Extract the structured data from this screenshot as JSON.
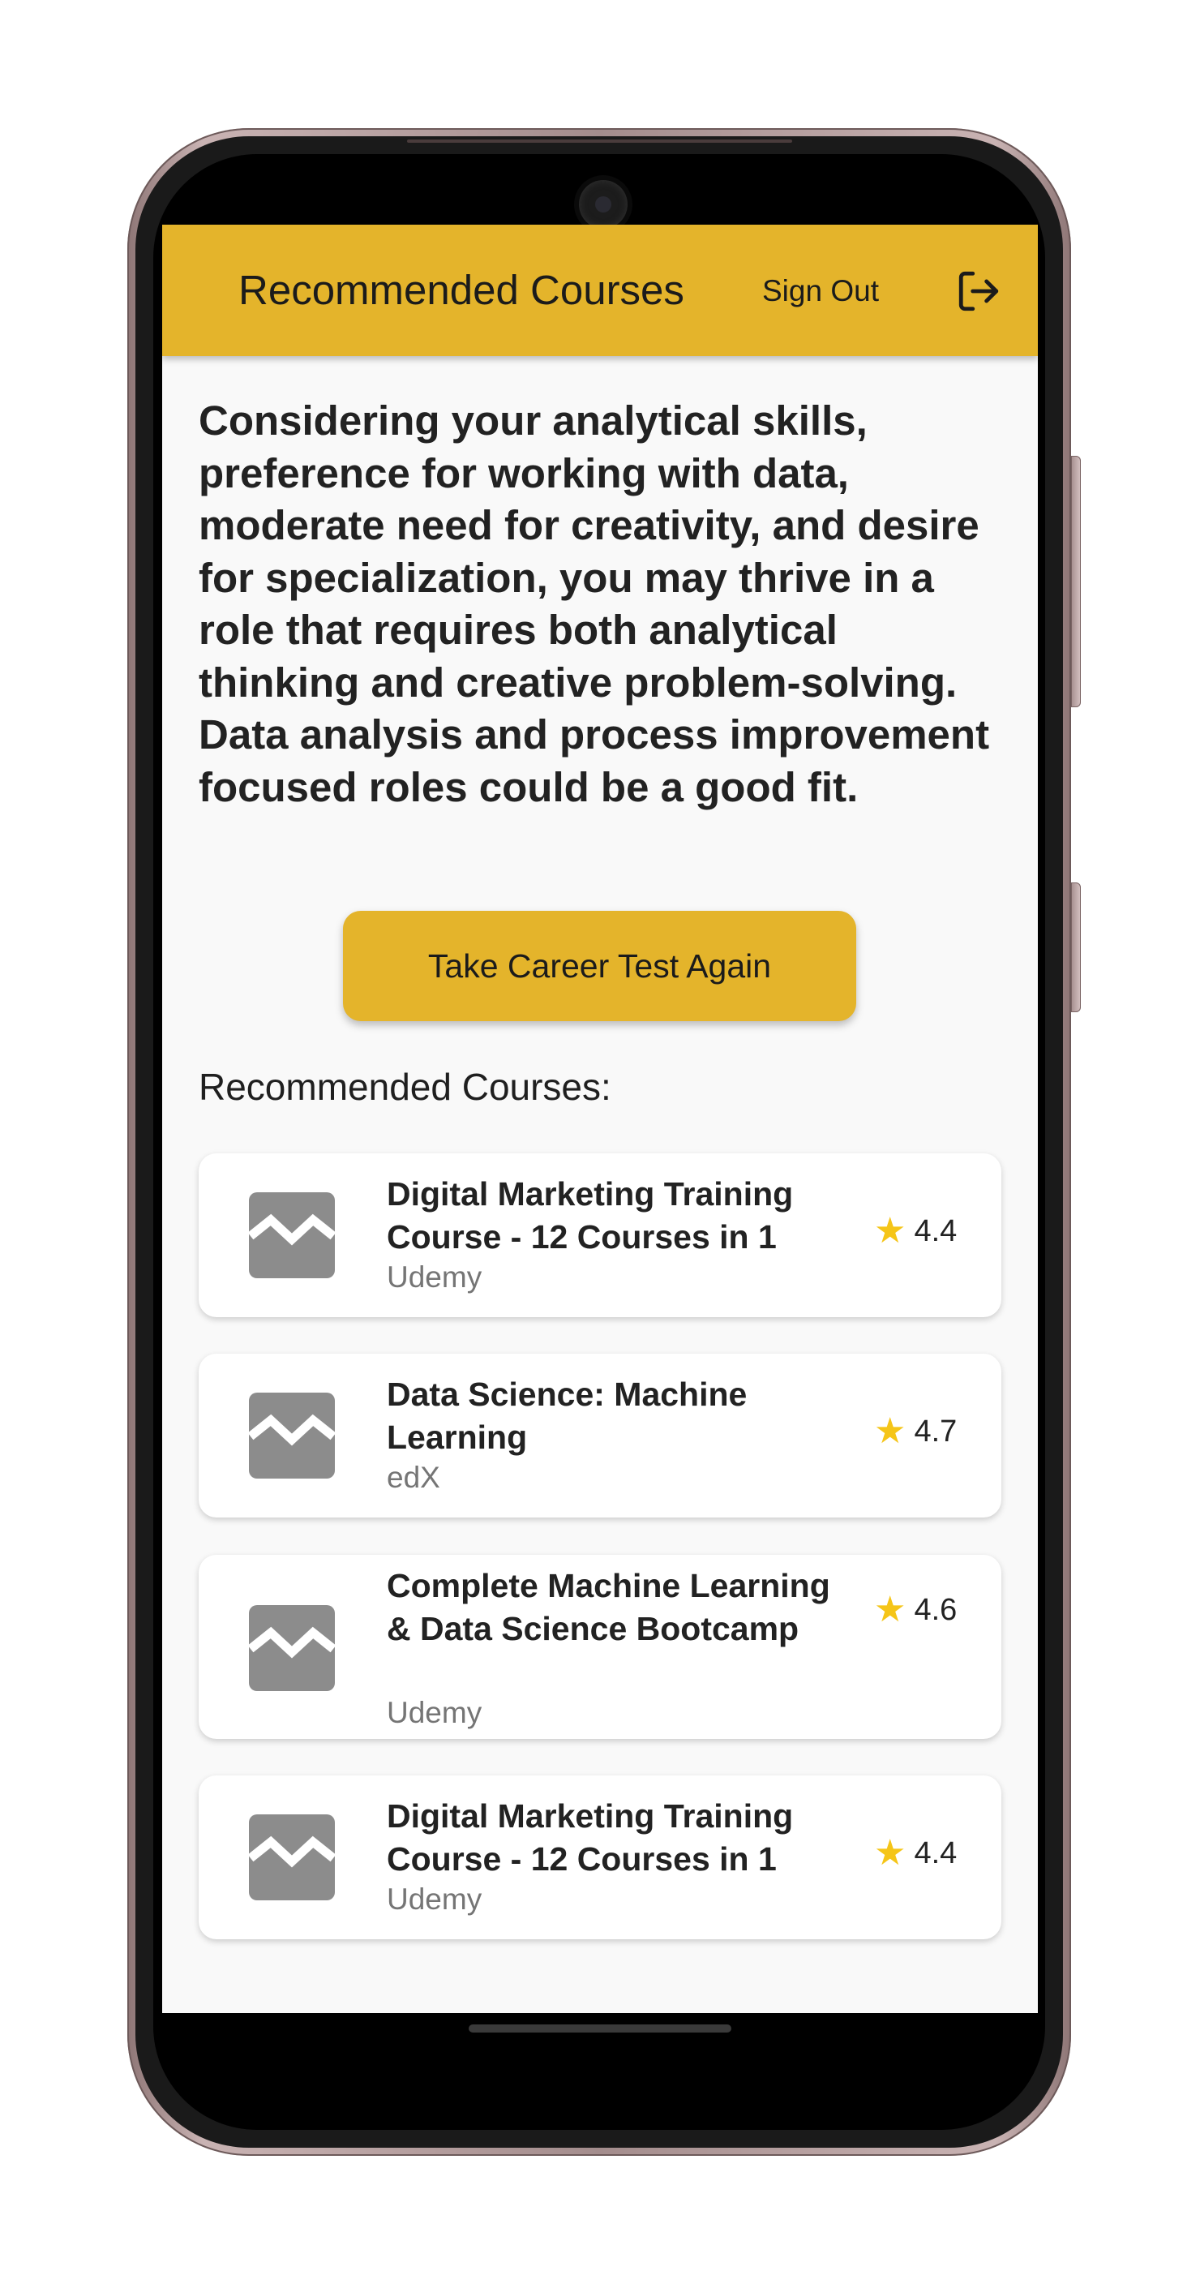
{
  "app_bar": {
    "title": "Recommended Courses",
    "sign_out_label": "Sign Out",
    "logout_icon": "logout-icon",
    "background_color": "#e4b42b"
  },
  "intro_text": "Considering your analytical skills, preference for working with data, moderate need for creativity, and desire for specialization, you may thrive in a role that requires both analytical thinking and creative problem-solving. Data analysis and process improvement focused roles could be a good fit.",
  "cta_button_label": "Take Career Test Again",
  "section_title": "Recommended Courses:",
  "courses": [
    {
      "title": "Digital Marketing Training Course - 12 Courses in 1",
      "provider": "Udemy",
      "rating": "4.4",
      "icon": "image-placeholder-icon"
    },
    {
      "title": "Data Science: Machine Learning",
      "provider": "edX",
      "rating": "4.7",
      "icon": "image-placeholder-icon"
    },
    {
      "title": "Complete Machine Learning & Data Science Bootcamp",
      "provider": "Udemy",
      "rating": "4.6",
      "icon": "image-placeholder-icon"
    },
    {
      "title": "Digital Marketing Training Course - 12 Courses in 1",
      "provider": "Udemy",
      "rating": "4.4",
      "icon": "image-placeholder-icon"
    }
  ],
  "star_icon": "star-icon"
}
